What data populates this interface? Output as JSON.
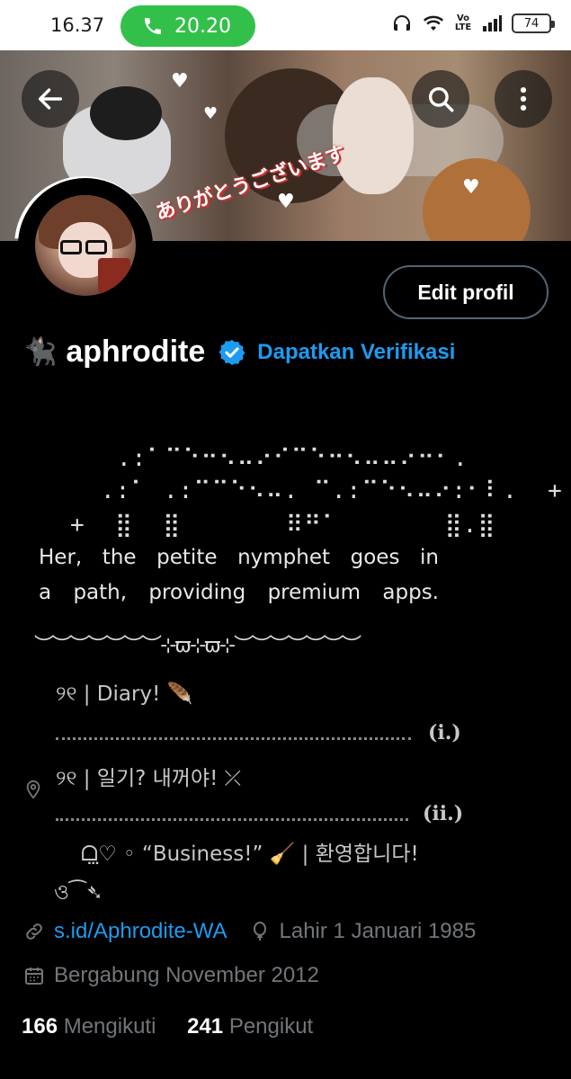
{
  "status_bar": {
    "time": "16.37",
    "call_duration": "20.20",
    "battery": "74",
    "network_label": "Vo LTE"
  },
  "banner": {
    "sticker_text": "ありがとうございます"
  },
  "header_icons": {
    "back": "arrow-left-icon",
    "search": "search-icon",
    "more": "more-vertical-icon"
  },
  "profile": {
    "edit_button": "Edit profil",
    "name_emoji": "🐈‍⬛",
    "display_name": "aphrodite",
    "get_verified": "Dapatkan Verifikasi"
  },
  "bio": {
    "ascii_line1": ".:⠁⠉⠑⠒⠢⠤⠔⠊⠉⠑⠒⠢⠤⠤⠔⠒⠂.",
    "ascii_line2": ".:⠁ .:⠉⠉⠑⠢⠤. ⠉.:⠉⠑⠢⠤⠔:⠂⠇.  +",
    "ascii_line3": "+  ⣿  ⣿       ⠿⠛⠁       ⣿.⣿",
    "line1": "Her, the petite nymphet goes in",
    "line2": "a path, providing premium apps.",
    "divider": "︶︶︶︶︶︶︶⊹ϖ⊹ϖ⊹︶︶︶︶︶︶︶",
    "item1": "୨୧ | Diary! 🪶",
    "item1_num": "(i.)",
    "item2": "୨୧ | 일기? 내꺼야! ⤫",
    "item2_num": "(ii.)",
    "item3": "ᗝ⃨♡ ◦ “Business!” 🧹 | 환영합니다!",
    "item4": "ও⁀➴"
  },
  "meta": {
    "link": "s.id/Aphrodite-WA",
    "birthday": "Lahir 1 Januari 1985",
    "joined": "Bergabung November 2012"
  },
  "stats": {
    "following_count": "166",
    "following_label": "Mengikuti",
    "followers_count": "241",
    "followers_label": "Pengikut"
  },
  "colors": {
    "accent": "#1d9bf0",
    "call_green": "#33c04a",
    "background": "#000000",
    "muted": "#71767b"
  }
}
